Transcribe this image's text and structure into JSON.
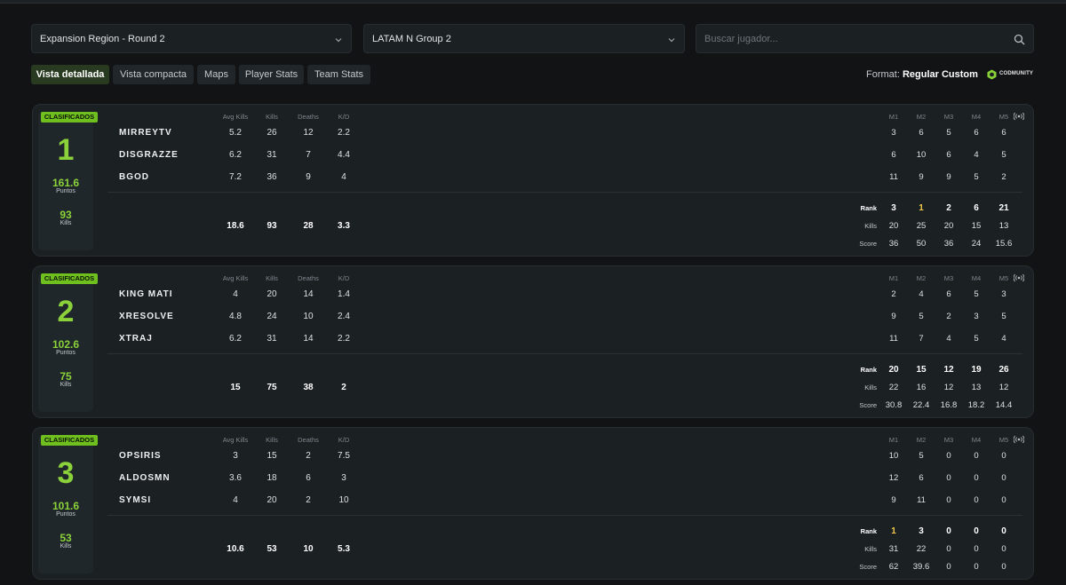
{
  "filters": {
    "round": "Expansion Region - Round 2",
    "group": "LATAM N Group 2",
    "search_placeholder": "Buscar jugador..."
  },
  "tabs": [
    "Vista detallada",
    "Vista compacta",
    "Maps",
    "Player Stats",
    "Team Stats"
  ],
  "format": {
    "label": "Format:",
    "value": "Regular Custom"
  },
  "brand": "CODMUNITY",
  "headers": {
    "avg_kills": "Avg Kills",
    "kills": "Kills",
    "deaths": "Deaths",
    "kd": "K/D",
    "maps": [
      "M1",
      "M2",
      "M3",
      "M4",
      "M5"
    ]
  },
  "row_labels": {
    "rank": "Rank",
    "kills": "Kills",
    "score": "Score"
  },
  "colors": {
    "accent": "#8bd23a",
    "badge": "#6fbf1f",
    "gold": "#f2c94c"
  },
  "teams": [
    {
      "badge": "CLASIFICADOS",
      "position": "1",
      "points": "161.6",
      "points_label": "Puntos",
      "kills": "93",
      "kills_label": "Kills",
      "players": [
        {
          "name": "MIRREYTV",
          "avg": "5.2",
          "kills": "26",
          "deaths": "12",
          "kd": "2.2",
          "maps": [
            "3",
            "6",
            "5",
            "6",
            "6"
          ]
        },
        {
          "name": "DISGRAZZE",
          "avg": "6.2",
          "kills": "31",
          "deaths": "7",
          "kd": "4.4",
          "maps": [
            "6",
            "10",
            "6",
            "4",
            "5"
          ]
        },
        {
          "name": "BGOD",
          "avg": "7.2",
          "kills": "36",
          "deaths": "9",
          "kd": "4",
          "maps": [
            "11",
            "9",
            "9",
            "5",
            "2"
          ]
        }
      ],
      "totals": {
        "avg": "18.6",
        "kills": "93",
        "deaths": "28",
        "kd": "3.3"
      },
      "map_rank": [
        "3",
        "1",
        "2",
        "6",
        "21"
      ],
      "map_kills": [
        "20",
        "25",
        "20",
        "15",
        "13"
      ],
      "map_score": [
        "36",
        "50",
        "36",
        "24",
        "15.6"
      ]
    },
    {
      "badge": "CLASIFICADOS",
      "position": "2",
      "points": "102.6",
      "points_label": "Puntos",
      "kills": "75",
      "kills_label": "Kills",
      "players": [
        {
          "name": "KING MATI",
          "avg": "4",
          "kills": "20",
          "deaths": "14",
          "kd": "1.4",
          "maps": [
            "2",
            "4",
            "6",
            "5",
            "3"
          ]
        },
        {
          "name": "XRESOLVE",
          "avg": "4.8",
          "kills": "24",
          "deaths": "10",
          "kd": "2.4",
          "maps": [
            "9",
            "5",
            "2",
            "3",
            "5"
          ]
        },
        {
          "name": "XTRAJ",
          "avg": "6.2",
          "kills": "31",
          "deaths": "14",
          "kd": "2.2",
          "maps": [
            "11",
            "7",
            "4",
            "5",
            "4"
          ]
        }
      ],
      "totals": {
        "avg": "15",
        "kills": "75",
        "deaths": "38",
        "kd": "2"
      },
      "map_rank": [
        "20",
        "15",
        "12",
        "19",
        "26"
      ],
      "map_kills": [
        "22",
        "16",
        "12",
        "13",
        "12"
      ],
      "map_score": [
        "30.8",
        "22.4",
        "16.8",
        "18.2",
        "14.4"
      ]
    },
    {
      "badge": "CLASIFICADOS",
      "position": "3",
      "points": "101.6",
      "points_label": "Puntos",
      "kills": "53",
      "kills_label": "Kills",
      "players": [
        {
          "name": "OPSIRIS",
          "avg": "3",
          "kills": "15",
          "deaths": "2",
          "kd": "7.5",
          "maps": [
            "10",
            "5",
            "0",
            "0",
            "0"
          ]
        },
        {
          "name": "ALDOSMN",
          "avg": "3.6",
          "kills": "18",
          "deaths": "6",
          "kd": "3",
          "maps": [
            "12",
            "6",
            "0",
            "0",
            "0"
          ]
        },
        {
          "name": "SYMSI",
          "avg": "4",
          "kills": "20",
          "deaths": "2",
          "kd": "10",
          "maps": [
            "9",
            "11",
            "0",
            "0",
            "0"
          ]
        }
      ],
      "totals": {
        "avg": "10.6",
        "kills": "53",
        "deaths": "10",
        "kd": "5.3"
      },
      "map_rank": [
        "1",
        "3",
        "0",
        "0",
        "0"
      ],
      "map_kills": [
        "31",
        "22",
        "0",
        "0",
        "0"
      ],
      "map_score": [
        "62",
        "39.6",
        "0",
        "0",
        "0"
      ]
    }
  ]
}
